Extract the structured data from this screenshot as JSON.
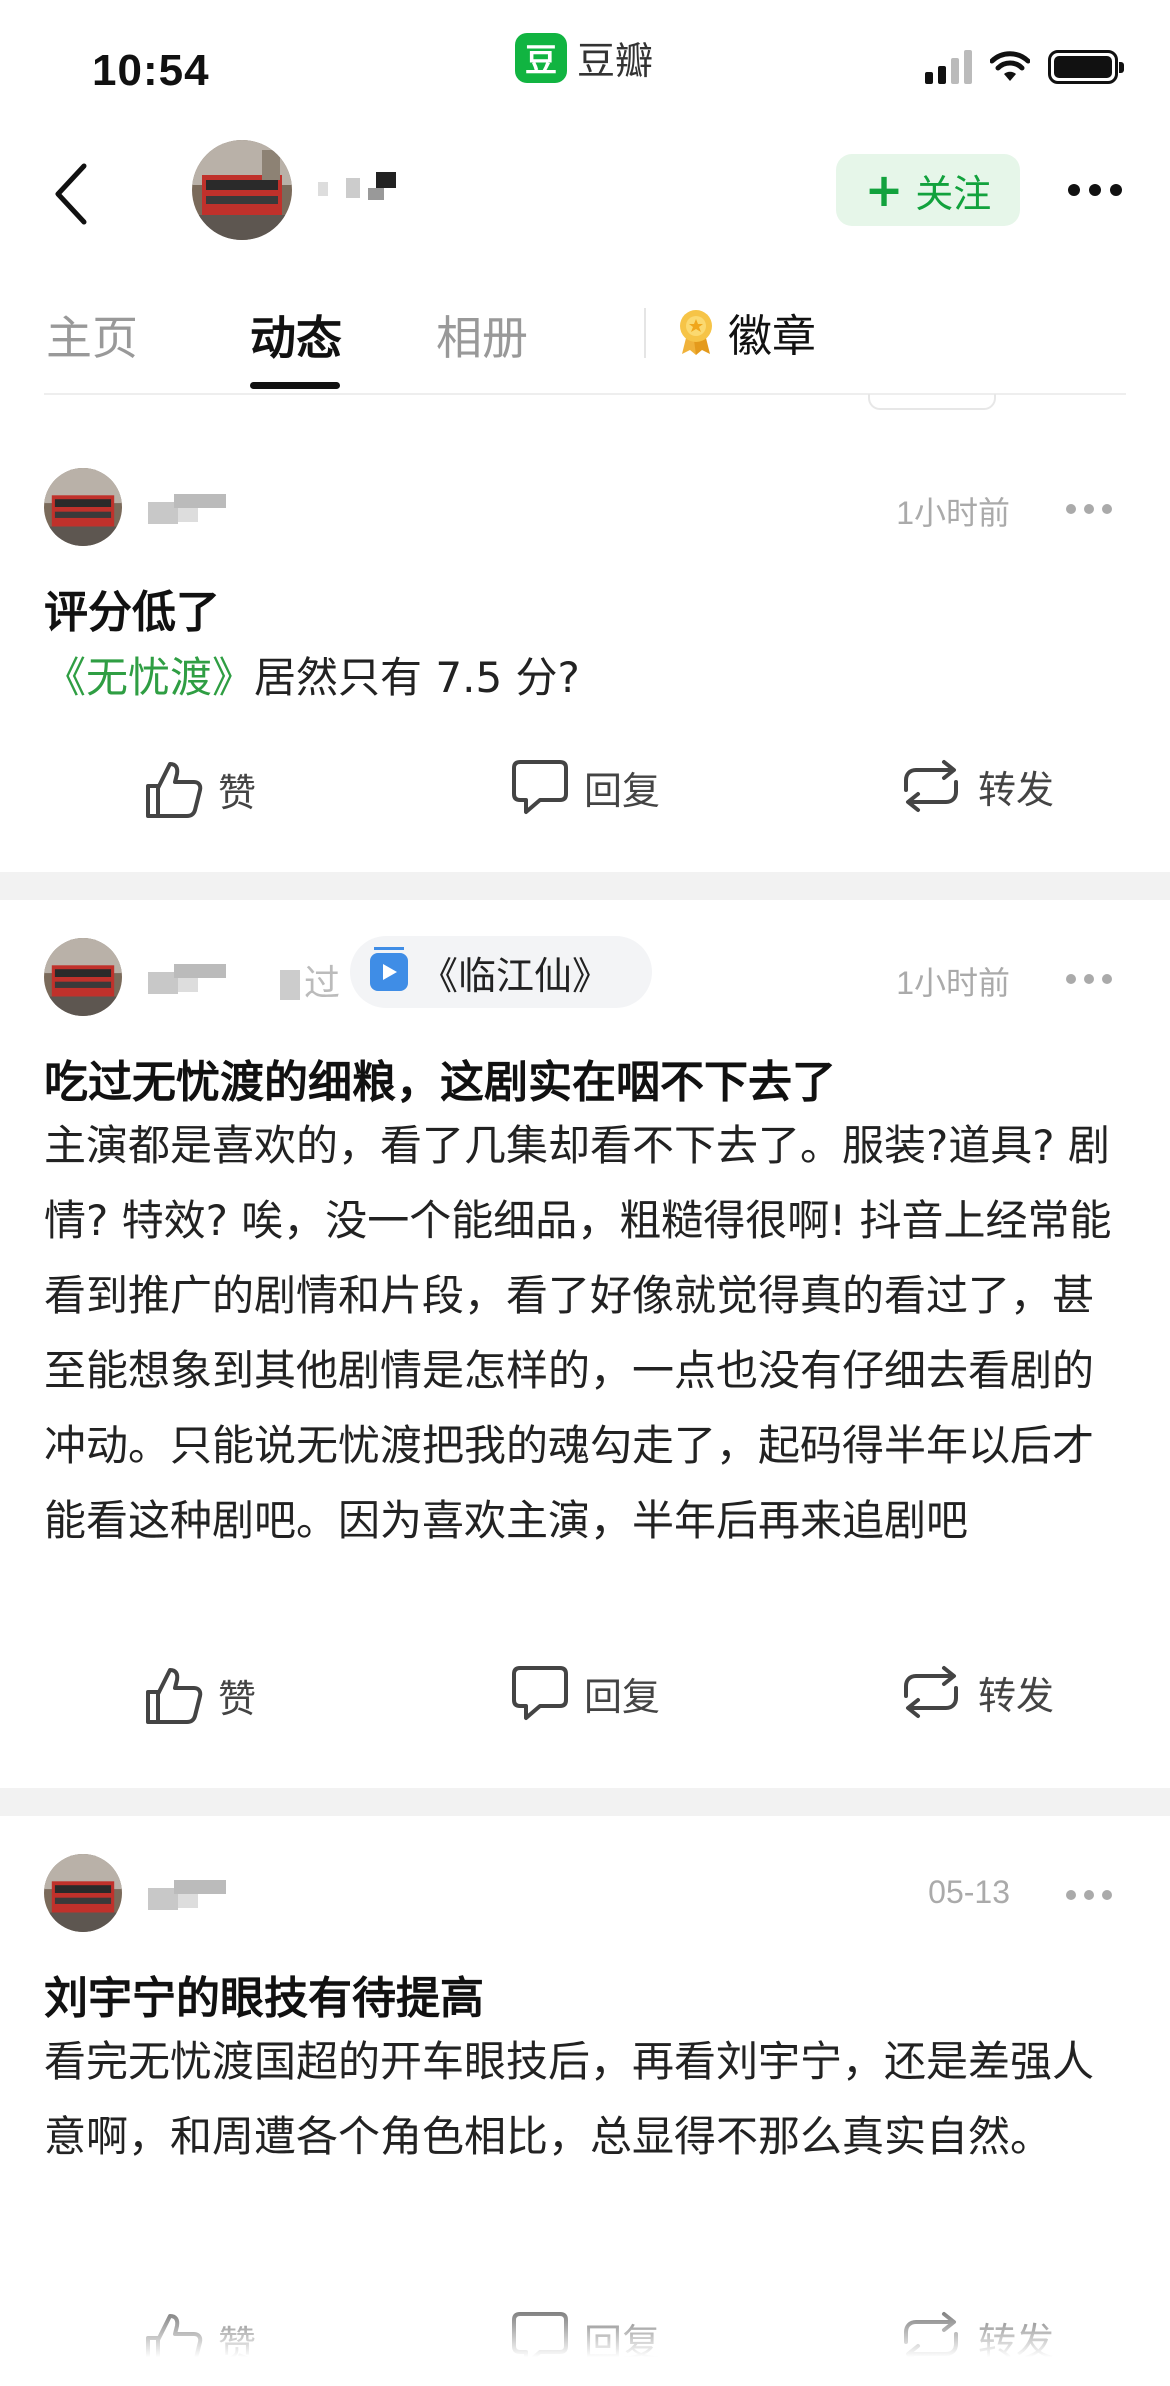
{
  "status_bar": {
    "time": "10:54",
    "app_name": "豆瓣",
    "app_logo_char": "豆"
  },
  "header": {
    "follow_label": "关注",
    "follow_plus": "+"
  },
  "tabs": [
    {
      "label": "主页",
      "active": false
    },
    {
      "label": "动态",
      "active": true
    },
    {
      "label": "相册",
      "active": false
    },
    {
      "label": "徽章",
      "active": false
    }
  ],
  "posts": [
    {
      "time": "1小时前",
      "title": "评分低了",
      "body_link": "《无忧渡》",
      "body_rest": "居然只有 7.5 分?",
      "actions": {
        "like": "赞",
        "reply": "回复",
        "share": "转发"
      }
    },
    {
      "time": "1小时前",
      "topic_prefix": "过",
      "topic": "《临江仙》",
      "title": "吃过无忧渡的细粮，这剧实在咽不下去了",
      "body": "主演都是喜欢的，看了几集却看不下去了。服装?道具? 剧情? 特效? 唉，没一个能细品，粗糙得很啊! 抖音上经常能看到推广的剧情和片段，看了好像就觉得真的看过了，甚至能想象到其他剧情是怎样的，一点也没有仔细去看剧的冲动。只能说无忧渡把我的魂勾走了，起码得半年以后才能看这种剧吧。因为喜欢主演，半年后再来追剧吧",
      "actions": {
        "like": "赞",
        "reply": "回复",
        "share": "转发"
      }
    },
    {
      "time": "05-13",
      "title": "刘宇宁的眼技有待提高",
      "body": "看完无忧渡国超的开车眼技后，再看刘宇宁，还是差强人意啊，和周遭各个角色相比，总显得不那么真实自然。",
      "actions": {
        "like": "赞",
        "reply": "回复",
        "share": "转发"
      }
    }
  ],
  "colors": {
    "brand_green": "#11b441",
    "link_green": "#2f9e43",
    "follow_bg": "#e6f6e9"
  }
}
